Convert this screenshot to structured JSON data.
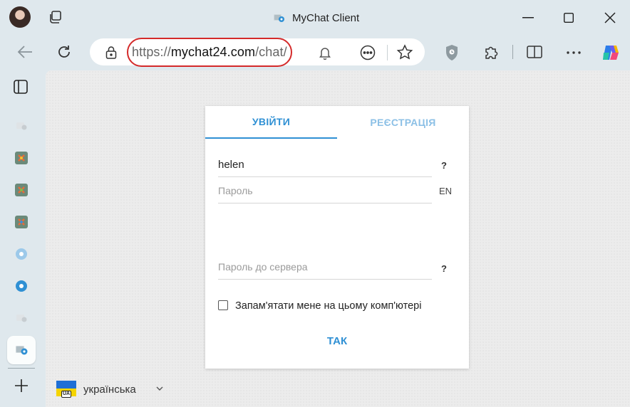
{
  "window": {
    "title": "MyChat Client"
  },
  "browser": {
    "url": {
      "scheme": "https://",
      "host": "mychat24.com",
      "path": "/chat/"
    }
  },
  "login": {
    "tabs": {
      "login": "УВІЙТИ",
      "register": "РЕЄСТРАЦІЯ"
    },
    "username_value": "helen",
    "username_help": "?",
    "password_placeholder": "Пароль",
    "keyboard_layout": "EN",
    "server_password_placeholder": "Пароль до сервера",
    "server_password_help": "?",
    "remember_label": "Запам'ятати мене на цьому комп'ютері",
    "submit_label": "ТАК"
  },
  "language": {
    "flag_badge": "UA",
    "selected": "українська"
  },
  "colors": {
    "accent": "#2f90d4",
    "highlight_ring": "#d42a2a"
  }
}
